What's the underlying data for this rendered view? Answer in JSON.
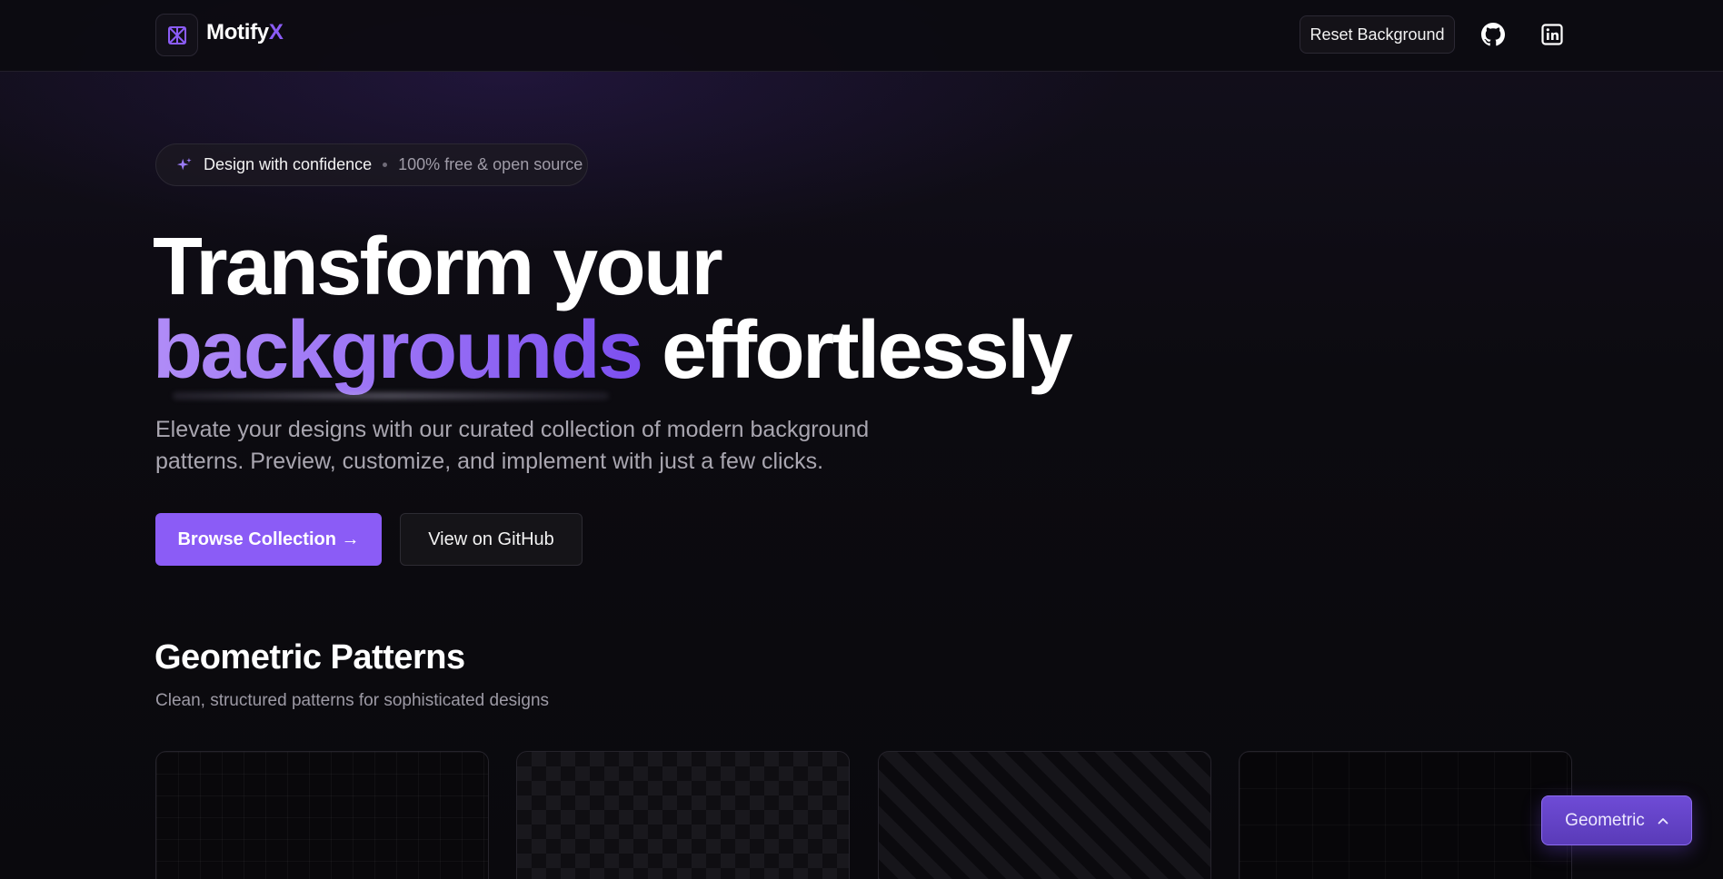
{
  "header": {
    "logo_main": "Motify",
    "logo_accent": "X",
    "reset_label": "Reset Background",
    "github_icon": "github-icon",
    "linkedin_icon": "linkedin-icon"
  },
  "badge": {
    "primary": "Design with confidence",
    "secondary": "100% free & open source",
    "icon": "sparkle-icon"
  },
  "hero": {
    "line1": "Transform your",
    "highlight": "backgrounds",
    "line2_rest": " effortlessly",
    "subtitle": "Elevate your designs with our curated collection of modern background patterns. Preview, customize, and implement with just a few clicks.",
    "primary_cta": "Browse Collection →",
    "secondary_cta": "View on GitHub"
  },
  "section": {
    "title": "Geometric Patterns",
    "subtitle": "Clean, structured patterns for sophisticated designs"
  },
  "floating": {
    "label": "Geometric",
    "icon": "chevron-up-icon"
  },
  "colors": {
    "accent": "#8b5cf6",
    "background": "#0a090d"
  }
}
